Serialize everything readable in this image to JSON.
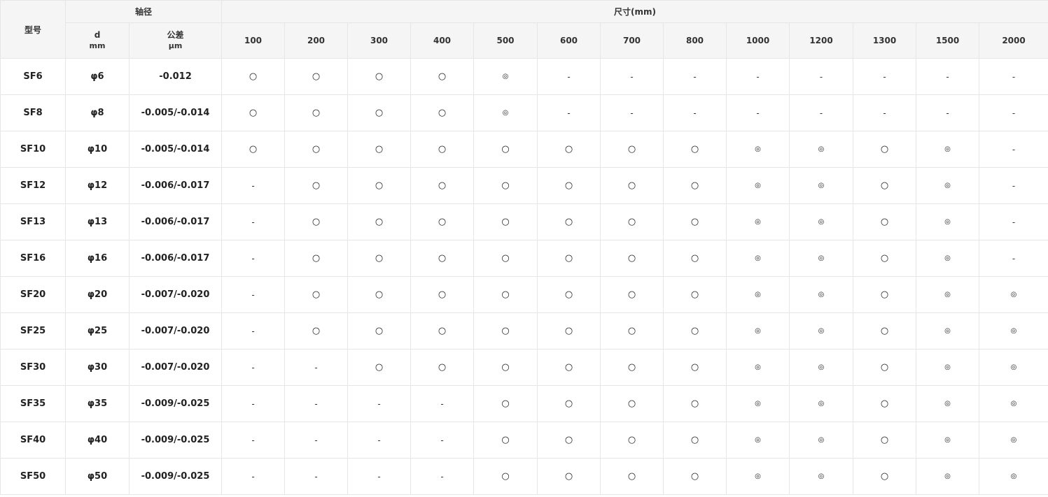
{
  "header": {
    "model": "型号",
    "shaft": "轴径",
    "size": "尺寸(mm)",
    "d_label": "d",
    "d_unit": "mm",
    "tol_label": "公差",
    "tol_unit": "μm",
    "lengths": [
      "100",
      "200",
      "300",
      "400",
      "500",
      "600",
      "700",
      "800",
      "1000",
      "1200",
      "1300",
      "1500",
      "2000"
    ]
  },
  "rows": [
    {
      "model": "SF6",
      "d": "φ6",
      "tol": "-0.012",
      "marks": [
        "○",
        "○",
        "○",
        "○",
        "◎",
        "-",
        "-",
        "-",
        "-",
        "-",
        "-",
        "-",
        "-"
      ]
    },
    {
      "model": "SF8",
      "d": "φ8",
      "tol": "-0.005/-0.014",
      "marks": [
        "○",
        "○",
        "○",
        "○",
        "◎",
        "-",
        "-",
        "-",
        "-",
        "-",
        "-",
        "-",
        "-"
      ]
    },
    {
      "model": "SF10",
      "d": "φ10",
      "tol": "-0.005/-0.014",
      "marks": [
        "○",
        "○",
        "○",
        "○",
        "○",
        "○",
        "○",
        "○",
        "◎",
        "◎",
        "○",
        "◎",
        "-"
      ]
    },
    {
      "model": "SF12",
      "d": "φ12",
      "tol": "-0.006/-0.017",
      "marks": [
        "-",
        "○",
        "○",
        "○",
        "○",
        "○",
        "○",
        "○",
        "◎",
        "◎",
        "○",
        "◎",
        "-"
      ]
    },
    {
      "model": "SF13",
      "d": "φ13",
      "tol": "-0.006/-0.017",
      "marks": [
        "-",
        "○",
        "○",
        "○",
        "○",
        "○",
        "○",
        "○",
        "◎",
        "◎",
        "○",
        "◎",
        "-"
      ]
    },
    {
      "model": "SF16",
      "d": "φ16",
      "tol": "-0.006/-0.017",
      "marks": [
        "-",
        "○",
        "○",
        "○",
        "○",
        "○",
        "○",
        "○",
        "◎",
        "◎",
        "○",
        "◎",
        "-"
      ]
    },
    {
      "model": "SF20",
      "d": "φ20",
      "tol": "-0.007/-0.020",
      "marks": [
        "-",
        "○",
        "○",
        "○",
        "○",
        "○",
        "○",
        "○",
        "◎",
        "◎",
        "○",
        "◎",
        "◎"
      ]
    },
    {
      "model": "SF25",
      "d": "φ25",
      "tol": "-0.007/-0.020",
      "marks": [
        "-",
        "○",
        "○",
        "○",
        "○",
        "○",
        "○",
        "○",
        "◎",
        "◎",
        "○",
        "◎",
        "◎"
      ]
    },
    {
      "model": "SF30",
      "d": "φ30",
      "tol": "-0.007/-0.020",
      "marks": [
        "-",
        "-",
        "○",
        "○",
        "○",
        "○",
        "○",
        "○",
        "◎",
        "◎",
        "○",
        "◎",
        "◎"
      ]
    },
    {
      "model": "SF35",
      "d": "φ35",
      "tol": "-0.009/-0.025",
      "marks": [
        "-",
        "-",
        "-",
        "-",
        "○",
        "○",
        "○",
        "○",
        "◎",
        "◎",
        "○",
        "◎",
        "◎"
      ]
    },
    {
      "model": "SF40",
      "d": "φ40",
      "tol": "-0.009/-0.025",
      "marks": [
        "-",
        "-",
        "-",
        "-",
        "○",
        "○",
        "○",
        "○",
        "◎",
        "◎",
        "○",
        "◎",
        "◎"
      ]
    },
    {
      "model": "SF50",
      "d": "φ50",
      "tol": "-0.009/-0.025",
      "marks": [
        "-",
        "-",
        "-",
        "-",
        "○",
        "○",
        "○",
        "○",
        "◎",
        "◎",
        "○",
        "◎",
        "◎"
      ]
    }
  ]
}
